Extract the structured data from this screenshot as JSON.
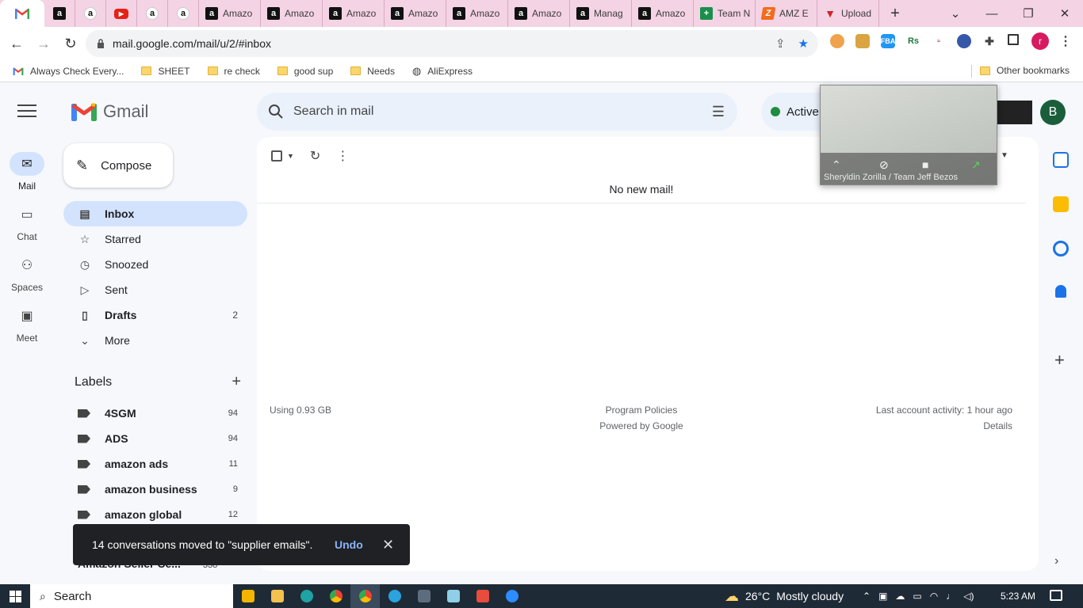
{
  "browser": {
    "tabs": [
      {
        "icon": "amazon-icon",
        "title": ""
      },
      {
        "icon": "amazon-icon",
        "title": ""
      },
      {
        "icon": "youtube-icon",
        "title": ""
      },
      {
        "icon": "amazon-icon",
        "title": ""
      },
      {
        "icon": "amazon-icon",
        "title": ""
      },
      {
        "icon": "amazon-icon",
        "title": "Amazo"
      },
      {
        "icon": "amazon-icon",
        "title": "Amazo"
      },
      {
        "icon": "amazon-icon",
        "title": "Amazo"
      },
      {
        "icon": "amazon-icon",
        "title": "Amazo"
      },
      {
        "icon": "amazon-icon",
        "title": "Amazo"
      },
      {
        "icon": "amazon-icon",
        "title": "Amazo"
      },
      {
        "icon": "amazon-icon",
        "title": "Manag"
      },
      {
        "icon": "amazon-icon",
        "title": "Amazo"
      },
      {
        "icon": "sheets-icon",
        "title": "Team N"
      },
      {
        "icon": "amz-icon",
        "title": "AMZ E"
      },
      {
        "icon": "upload-icon",
        "title": "Upload"
      }
    ],
    "url": "mail.google.com/mail/u/2/#inbox",
    "bookmarks": [
      {
        "label": "Always Check Every...",
        "icon": "gmail-icon"
      },
      {
        "label": "SHEET",
        "icon": "folder-icon"
      },
      {
        "label": "re check",
        "icon": "folder-icon"
      },
      {
        "label": "good sup",
        "icon": "folder-icon"
      },
      {
        "label": "Needs",
        "icon": "folder-icon"
      },
      {
        "label": "AliExpress",
        "icon": "globe-icon"
      }
    ],
    "other_bookmarks": "Other bookmarks",
    "profile_letter": "r"
  },
  "gmail": {
    "brand": "Gmail",
    "rail": [
      {
        "label": "Mail",
        "icon": "mail-icon"
      },
      {
        "label": "Chat",
        "icon": "chat-icon"
      },
      {
        "label": "Spaces",
        "icon": "spaces-icon"
      },
      {
        "label": "Meet",
        "icon": "meet-icon"
      }
    ],
    "compose": "Compose",
    "nav": [
      {
        "label": "Inbox",
        "count": "",
        "icon": "inbox-icon"
      },
      {
        "label": "Starred",
        "count": "",
        "icon": "star-icon"
      },
      {
        "label": "Snoozed",
        "count": "",
        "icon": "clock-icon"
      },
      {
        "label": "Sent",
        "count": "",
        "icon": "send-icon"
      },
      {
        "label": "Drafts",
        "count": "2",
        "icon": "draft-icon"
      },
      {
        "label": "More",
        "count": "",
        "icon": "chevron-down-icon"
      }
    ],
    "labels_title": "Labels",
    "labels": [
      {
        "label": "4SGM",
        "count": "94"
      },
      {
        "label": "ADS",
        "count": "94"
      },
      {
        "label": "amazon ads",
        "count": "11"
      },
      {
        "label": "amazon business",
        "count": "9"
      },
      {
        "label": "amazon global",
        "count": "12"
      }
    ],
    "partial_label": {
      "label": "Amazon Seller Ce...",
      "count": "338"
    },
    "search_placeholder": "Search in mail",
    "status": "Active",
    "avatar_letter": "B",
    "empty_text": "No new mail!",
    "footer": {
      "storage": "Using 0.93 GB",
      "policies": "Program Policies",
      "powered": "Powered by Google",
      "activity": "Last account activity: 1 hour ago",
      "details": "Details"
    },
    "snackbar": {
      "message": "14 conversations moved to \"supplier emails\".",
      "undo": "Undo"
    }
  },
  "video_overlay": {
    "participant": "Sheryldin Zorilla / Team Jeff Bezos"
  },
  "taskbar": {
    "search": "Search",
    "temperature": "26°C",
    "weather": "Mostly cloudy",
    "time": "5:23 AM"
  }
}
